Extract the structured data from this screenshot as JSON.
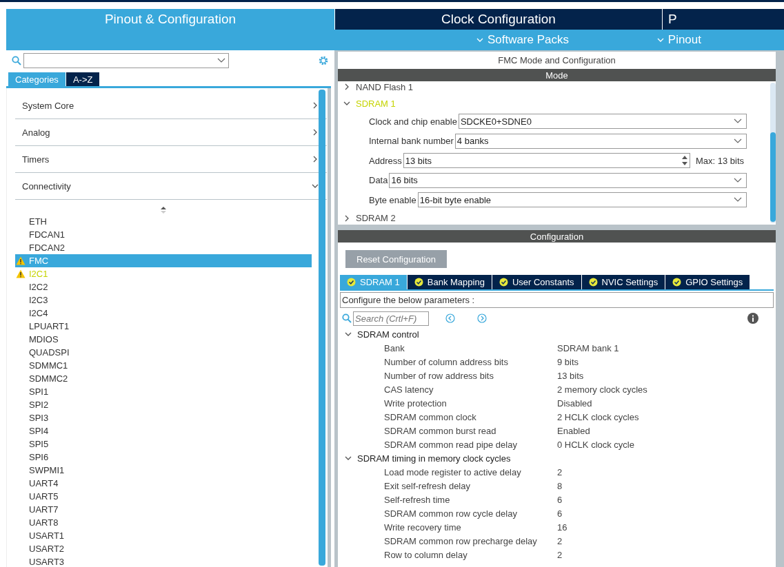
{
  "top_tabs": [
    {
      "label": "Pinout & Configuration",
      "selected": true
    },
    {
      "label": "Clock Configuration",
      "selected": false
    },
    {
      "label": "P",
      "selected": false
    }
  ],
  "sub_menu": [
    "Software Packs",
    "Pinout"
  ],
  "left": {
    "view_tabs": [
      {
        "label": "Categories",
        "selected": true
      },
      {
        "label": "A->Z",
        "selected": false
      }
    ],
    "categories": [
      {
        "label": "System Core",
        "expanded": false
      },
      {
        "label": "Analog",
        "expanded": false
      },
      {
        "label": "Timers",
        "expanded": false
      },
      {
        "label": "Connectivity",
        "expanded": true
      }
    ],
    "peripherals": [
      {
        "label": "ETH",
        "selected": false,
        "warning": false
      },
      {
        "label": "FDCAN1",
        "selected": false,
        "warning": false
      },
      {
        "label": "FDCAN2",
        "selected": false,
        "warning": false
      },
      {
        "label": "FMC",
        "selected": true,
        "warning": true
      },
      {
        "label": "I2C1",
        "selected": false,
        "warning": true
      },
      {
        "label": "I2C2",
        "selected": false,
        "warning": false
      },
      {
        "label": "I2C3",
        "selected": false,
        "warning": false
      },
      {
        "label": "I2C4",
        "selected": false,
        "warning": false
      },
      {
        "label": "LPUART1",
        "selected": false,
        "warning": false
      },
      {
        "label": "MDIOS",
        "selected": false,
        "warning": false
      },
      {
        "label": "QUADSPI",
        "selected": false,
        "warning": false
      },
      {
        "label": "SDMMC1",
        "selected": false,
        "warning": false
      },
      {
        "label": "SDMMC2",
        "selected": false,
        "warning": false
      },
      {
        "label": "SPI1",
        "selected": false,
        "warning": false
      },
      {
        "label": "SPI2",
        "selected": false,
        "warning": false
      },
      {
        "label": "SPI3",
        "selected": false,
        "warning": false
      },
      {
        "label": "SPI4",
        "selected": false,
        "warning": false
      },
      {
        "label": "SPI5",
        "selected": false,
        "warning": false
      },
      {
        "label": "SPI6",
        "selected": false,
        "warning": false
      },
      {
        "label": "SWPMI1",
        "selected": false,
        "warning": false
      },
      {
        "label": "UART4",
        "selected": false,
        "warning": false
      },
      {
        "label": "UART5",
        "selected": false,
        "warning": false
      },
      {
        "label": "UART7",
        "selected": false,
        "warning": false
      },
      {
        "label": "UART8",
        "selected": false,
        "warning": false
      },
      {
        "label": "USART1",
        "selected": false,
        "warning": false
      },
      {
        "label": "USART2",
        "selected": false,
        "warning": false
      },
      {
        "label": "USART3",
        "selected": false,
        "warning": false
      }
    ]
  },
  "mode": {
    "title": "FMC Mode and Configuration",
    "header": "Mode",
    "tree": [
      {
        "label": "NAND Flash 1",
        "expanded": false,
        "configured": false
      },
      {
        "label": "SDRAM 1",
        "expanded": true,
        "configured": true,
        "fields": [
          {
            "kind": "select",
            "label": "Clock and chip enable",
            "value": "SDCKE0+SDNE0"
          },
          {
            "kind": "select",
            "label": "Internal bank number",
            "value": "4 banks"
          },
          {
            "kind": "spinner",
            "label": "Address",
            "value": "13 bits",
            "note": "Max: 13 bits"
          },
          {
            "kind": "select",
            "label": "Data",
            "value": "16 bits"
          },
          {
            "kind": "select",
            "label": "Byte enable",
            "value": "16-bit byte enable"
          }
        ]
      },
      {
        "label": "SDRAM 2",
        "expanded": false,
        "configured": false
      }
    ]
  },
  "config": {
    "header": "Configuration",
    "reset_button": "Reset Configuration",
    "tabs": [
      {
        "label": "SDRAM 1",
        "selected": true
      },
      {
        "label": "Bank Mapping",
        "selected": false
      },
      {
        "label": "User Constants",
        "selected": false
      },
      {
        "label": "NVIC Settings",
        "selected": false
      },
      {
        "label": "GPIO Settings",
        "selected": false
      }
    ],
    "hint": "Configure the below parameters :",
    "search": {
      "placeholder": "Search (Crtl+F)"
    },
    "groups": [
      {
        "label": "SDRAM control",
        "expanded": true,
        "rows": [
          {
            "name": "Bank",
            "value": "SDRAM bank 1"
          },
          {
            "name": "Number of column address bits",
            "value": "9 bits"
          },
          {
            "name": "Number of row address bits",
            "value": "13 bits"
          },
          {
            "name": "CAS latency",
            "value": "2 memory clock cycles"
          },
          {
            "name": "Write protection",
            "value": "Disabled"
          },
          {
            "name": "SDRAM common clock",
            "value": "2 HCLK clock cycles"
          },
          {
            "name": "SDRAM common burst read",
            "value": "Enabled"
          },
          {
            "name": "SDRAM common read pipe delay",
            "value": "0 HCLK clock cycle"
          }
        ]
      },
      {
        "label": "SDRAM timing in memory clock cycles",
        "expanded": true,
        "rows": [
          {
            "name": "Load mode register to active delay",
            "value": "2"
          },
          {
            "name": "Exit self-refresh delay",
            "value": "8"
          },
          {
            "name": "Self-refresh time",
            "value": "6"
          },
          {
            "name": "SDRAM common row cycle delay",
            "value": "6"
          },
          {
            "name": "Write recovery time",
            "value": "16"
          },
          {
            "name": "SDRAM common row precharge delay",
            "value": "2"
          },
          {
            "name": "Row to column delay",
            "value": "2"
          }
        ]
      }
    ]
  }
}
